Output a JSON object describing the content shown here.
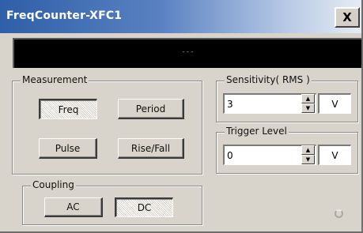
{
  "window": {
    "title": "FreqCounter-XFC1",
    "close_label": "X"
  },
  "display": {
    "value": "---"
  },
  "measurement": {
    "legend": "Measurement",
    "buttons": {
      "freq": "Freq",
      "period": "Period",
      "pulse": "Pulse",
      "rise_fall": "Rise/Fall"
    },
    "selected": "Freq"
  },
  "coupling": {
    "legend": "Coupling",
    "buttons": {
      "ac": "AC",
      "dc": "DC"
    },
    "selected": "DC"
  },
  "sensitivity": {
    "legend": "Sensitivity( RMS )",
    "value": "3",
    "unit": "V"
  },
  "trigger": {
    "legend": "Trigger Level",
    "value": "0",
    "unit": "V"
  },
  "icons": {
    "close": "close-icon",
    "spin_up": "spin-up-icon",
    "spin_down": "spin-down-icon",
    "resize": "resize-grip-icon"
  }
}
